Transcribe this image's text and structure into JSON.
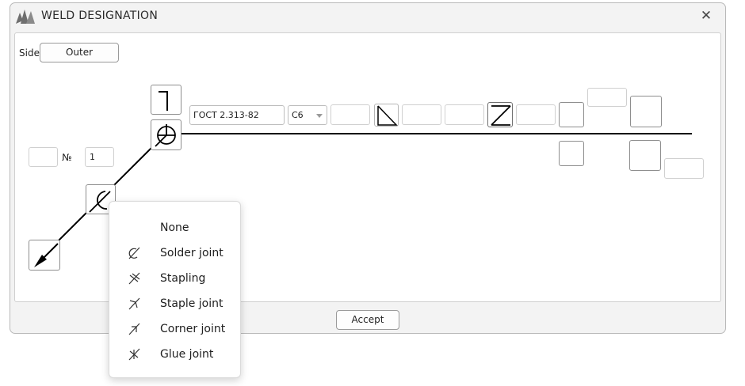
{
  "window": {
    "title": "WELD DESIGNATION"
  },
  "side": {
    "label": "Side",
    "value": "Outer"
  },
  "number": {
    "label": "№",
    "value": "1",
    "prefix_value": ""
  },
  "standard": {
    "value": "ГОСТ 2.313-82"
  },
  "type_select": {
    "value": "С6"
  },
  "accept_label": "Accept",
  "context_menu": {
    "items": [
      {
        "label": "None",
        "icon": "none"
      },
      {
        "label": "Solder joint",
        "icon": "solder-icon"
      },
      {
        "label": "Stapling",
        "icon": "stapling-icon"
      },
      {
        "label": "Staple joint",
        "icon": "staple-joint-icon"
      },
      {
        "label": "Corner joint",
        "icon": "corner-joint-icon"
      },
      {
        "label": "Glue joint",
        "icon": "glue-joint-icon"
      }
    ]
  }
}
